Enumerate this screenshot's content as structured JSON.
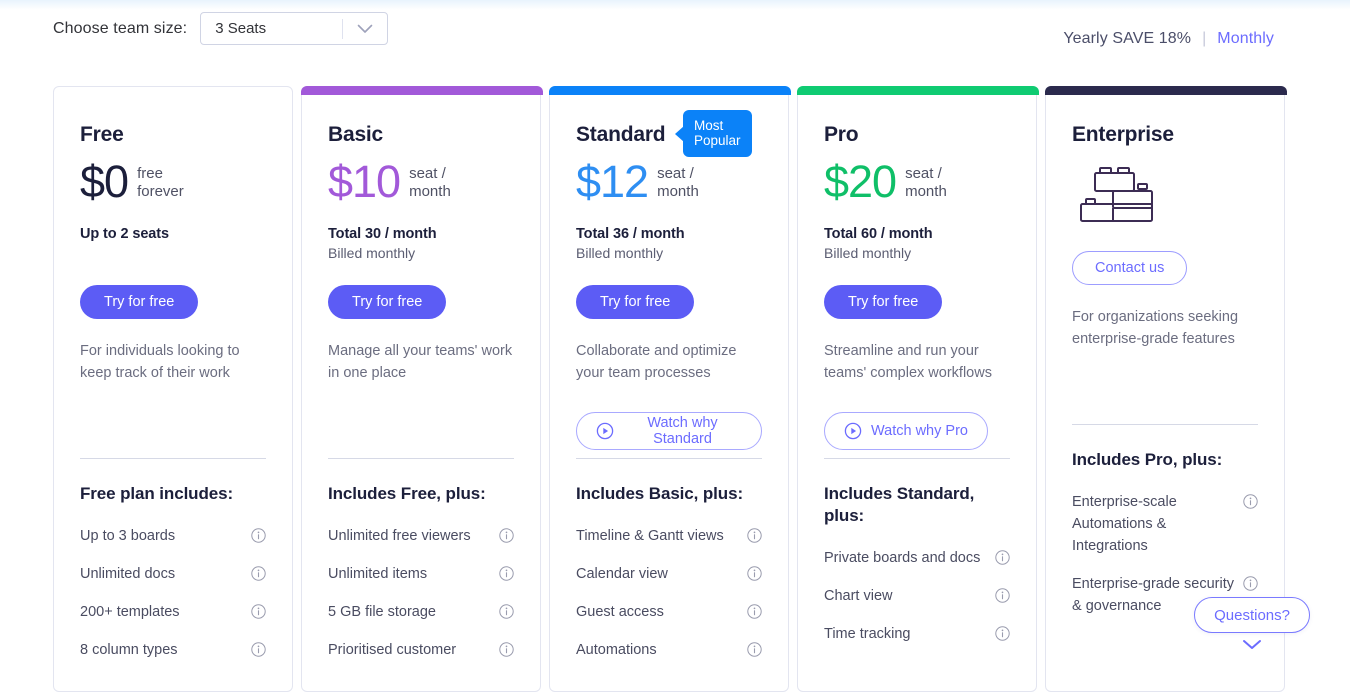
{
  "topbar": {
    "team_size_label": "Choose team size:",
    "seats_value": "3 Seats",
    "billing_yearly": "Yearly SAVE 18%",
    "billing_separator": "|",
    "billing_monthly": "Monthly"
  },
  "widget": {
    "questions_label": "Questions?"
  },
  "plans": [
    {
      "name": "Free",
      "accent": "#ffffff",
      "price": "$0",
      "price_color": "#1c1f3b",
      "unit_line1": "free",
      "unit_line2": "forever",
      "total": "Up to 2 seats",
      "billed": "",
      "cta": "Try for free",
      "cta_style": "primary",
      "description": "For individuals looking to keep track of their work",
      "watch": "",
      "features_title": "Free plan includes:",
      "features": [
        "Up to 3 boards",
        "Unlimited docs",
        "200+ templates",
        "8 column types"
      ]
    },
    {
      "name": "Basic",
      "accent": "#a259d9",
      "price": "$10",
      "price_color": "#a259d9",
      "unit_line1": "seat /",
      "unit_line2": "month",
      "total": "Total 30 / month",
      "billed": "Billed monthly",
      "cta": "Try for free",
      "cta_style": "primary",
      "description": "Manage all your teams' work in one place",
      "watch": "",
      "features_title": "Includes Free, plus:",
      "features": [
        "Unlimited free viewers",
        "Unlimited items",
        "5 GB file storage",
        "Prioritised customer"
      ]
    },
    {
      "name": "Standard",
      "accent": "#0b82f8",
      "price": "$12",
      "price_color": "#2e8ef2",
      "unit_line1": "seat /",
      "unit_line2": "month",
      "total": "Total 36 / month",
      "billed": "Billed monthly",
      "cta": "Try for free",
      "cta_style": "primary",
      "description": "Collaborate and optimize your team processes",
      "watch": "Watch why Standard",
      "badge": "Most Popular",
      "features_title": "Includes Basic, plus:",
      "features": [
        "Timeline & Gantt views",
        "Calendar view",
        "Guest access",
        "Automations"
      ]
    },
    {
      "name": "Pro",
      "accent": "#0fcb72",
      "price": "$20",
      "price_color": "#0fbf68",
      "unit_line1": "seat /",
      "unit_line2": "month",
      "total": "Total 60 / month",
      "billed": "Billed monthly",
      "cta": "Try for free",
      "cta_style": "primary",
      "description": "Streamline and run your teams' complex workflows",
      "watch": "Watch why Pro",
      "features_title": "Includes Standard, plus:",
      "features": [
        "Private boards and docs",
        "Chart view",
        "Time tracking"
      ]
    },
    {
      "name": "Enterprise",
      "accent": "#2b2a4d",
      "price": "",
      "price_color": "#2b2a4d",
      "unit_line1": "",
      "unit_line2": "",
      "total": "",
      "billed": "",
      "cta": "Contact us",
      "cta_style": "outline",
      "description": "For organizations seeking enterprise-grade features",
      "watch": "",
      "features_title": "Includes Pro, plus:",
      "features": [
        "Enterprise-scale Automations & Integrations",
        "Enterprise-grade security & governance"
      ]
    }
  ]
}
